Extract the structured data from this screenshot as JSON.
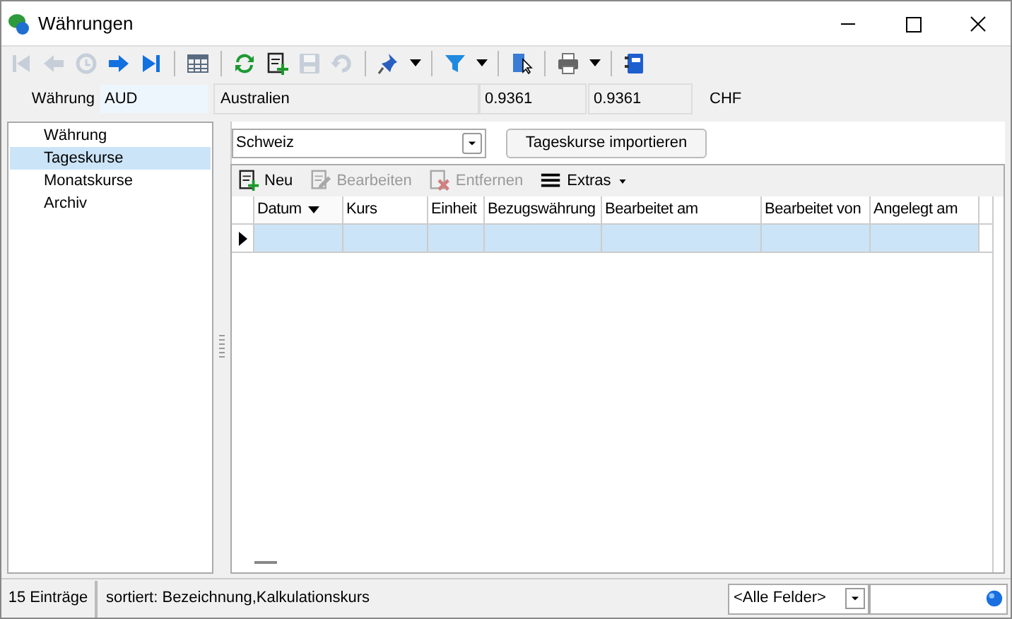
{
  "window": {
    "title": "Währungen"
  },
  "toolbar": [
    {
      "kind": "first",
      "disabled": true
    },
    {
      "kind": "previous",
      "disabled": true
    },
    {
      "kind": "history",
      "disabled": true
    },
    {
      "kind": "next",
      "disabled": false
    },
    {
      "kind": "last",
      "disabled": false
    },
    {
      "kind": "separator"
    },
    {
      "kind": "table",
      "disabled": false
    },
    {
      "kind": "separator"
    },
    {
      "kind": "refresh",
      "disabled": false
    },
    {
      "kind": "new",
      "disabled": false
    },
    {
      "kind": "save",
      "disabled": true
    },
    {
      "kind": "undo",
      "disabled": true
    },
    {
      "kind": "separator"
    },
    {
      "kind": "pin",
      "disabled": false,
      "dropdown": true
    },
    {
      "kind": "separator"
    },
    {
      "kind": "filter",
      "disabled": false,
      "dropdown": true
    },
    {
      "kind": "separator"
    },
    {
      "kind": "pointer",
      "disabled": false
    },
    {
      "kind": "separator"
    },
    {
      "kind": "print",
      "disabled": false,
      "dropdown": true
    },
    {
      "kind": "separator"
    },
    {
      "kind": "book",
      "disabled": false
    }
  ],
  "header": {
    "label": "Währung",
    "code": "AUD",
    "name": "Australien",
    "rate_1": "0.9361",
    "rate_2": "0.9361",
    "base": "CHF"
  },
  "sidebar": {
    "items": [
      {
        "label": "Währung",
        "selected": false
      },
      {
        "label": "Tageskurse",
        "selected": true
      },
      {
        "label": "Monatskurse",
        "selected": false
      },
      {
        "label": "Archiv",
        "selected": false
      }
    ]
  },
  "country_select": {
    "value": "Schweiz"
  },
  "import_button": "Tageskurse importieren",
  "grid_toolbar": [
    {
      "kind": "new",
      "label": "Neu",
      "disabled": false
    },
    {
      "kind": "edit",
      "label": "Bearbeiten",
      "disabled": true
    },
    {
      "kind": "delete",
      "label": "Entfernen",
      "disabled": true
    },
    {
      "kind": "menu",
      "label": "Extras",
      "disabled": false
    }
  ],
  "table": {
    "columns": [
      {
        "label": "Datum",
        "sorted": true
      },
      {
        "label": "Kurs",
        "sorted": false
      },
      {
        "label": "Einheit",
        "sorted": false
      },
      {
        "label": "Bezugswährung",
        "sorted": false
      },
      {
        "label": "Bearbeitet am",
        "sorted": false
      },
      {
        "label": "Bearbeitet von",
        "sorted": false
      },
      {
        "label": "Angelegt am",
        "sorted": false
      }
    ],
    "rows": [
      {
        "selected": true
      }
    ]
  },
  "status_bar": {
    "count": "15 Einträge",
    "sort": "sortiert: Bezeichnung,Kalkulationskurs",
    "field_filter": "<Alle Felder>"
  }
}
